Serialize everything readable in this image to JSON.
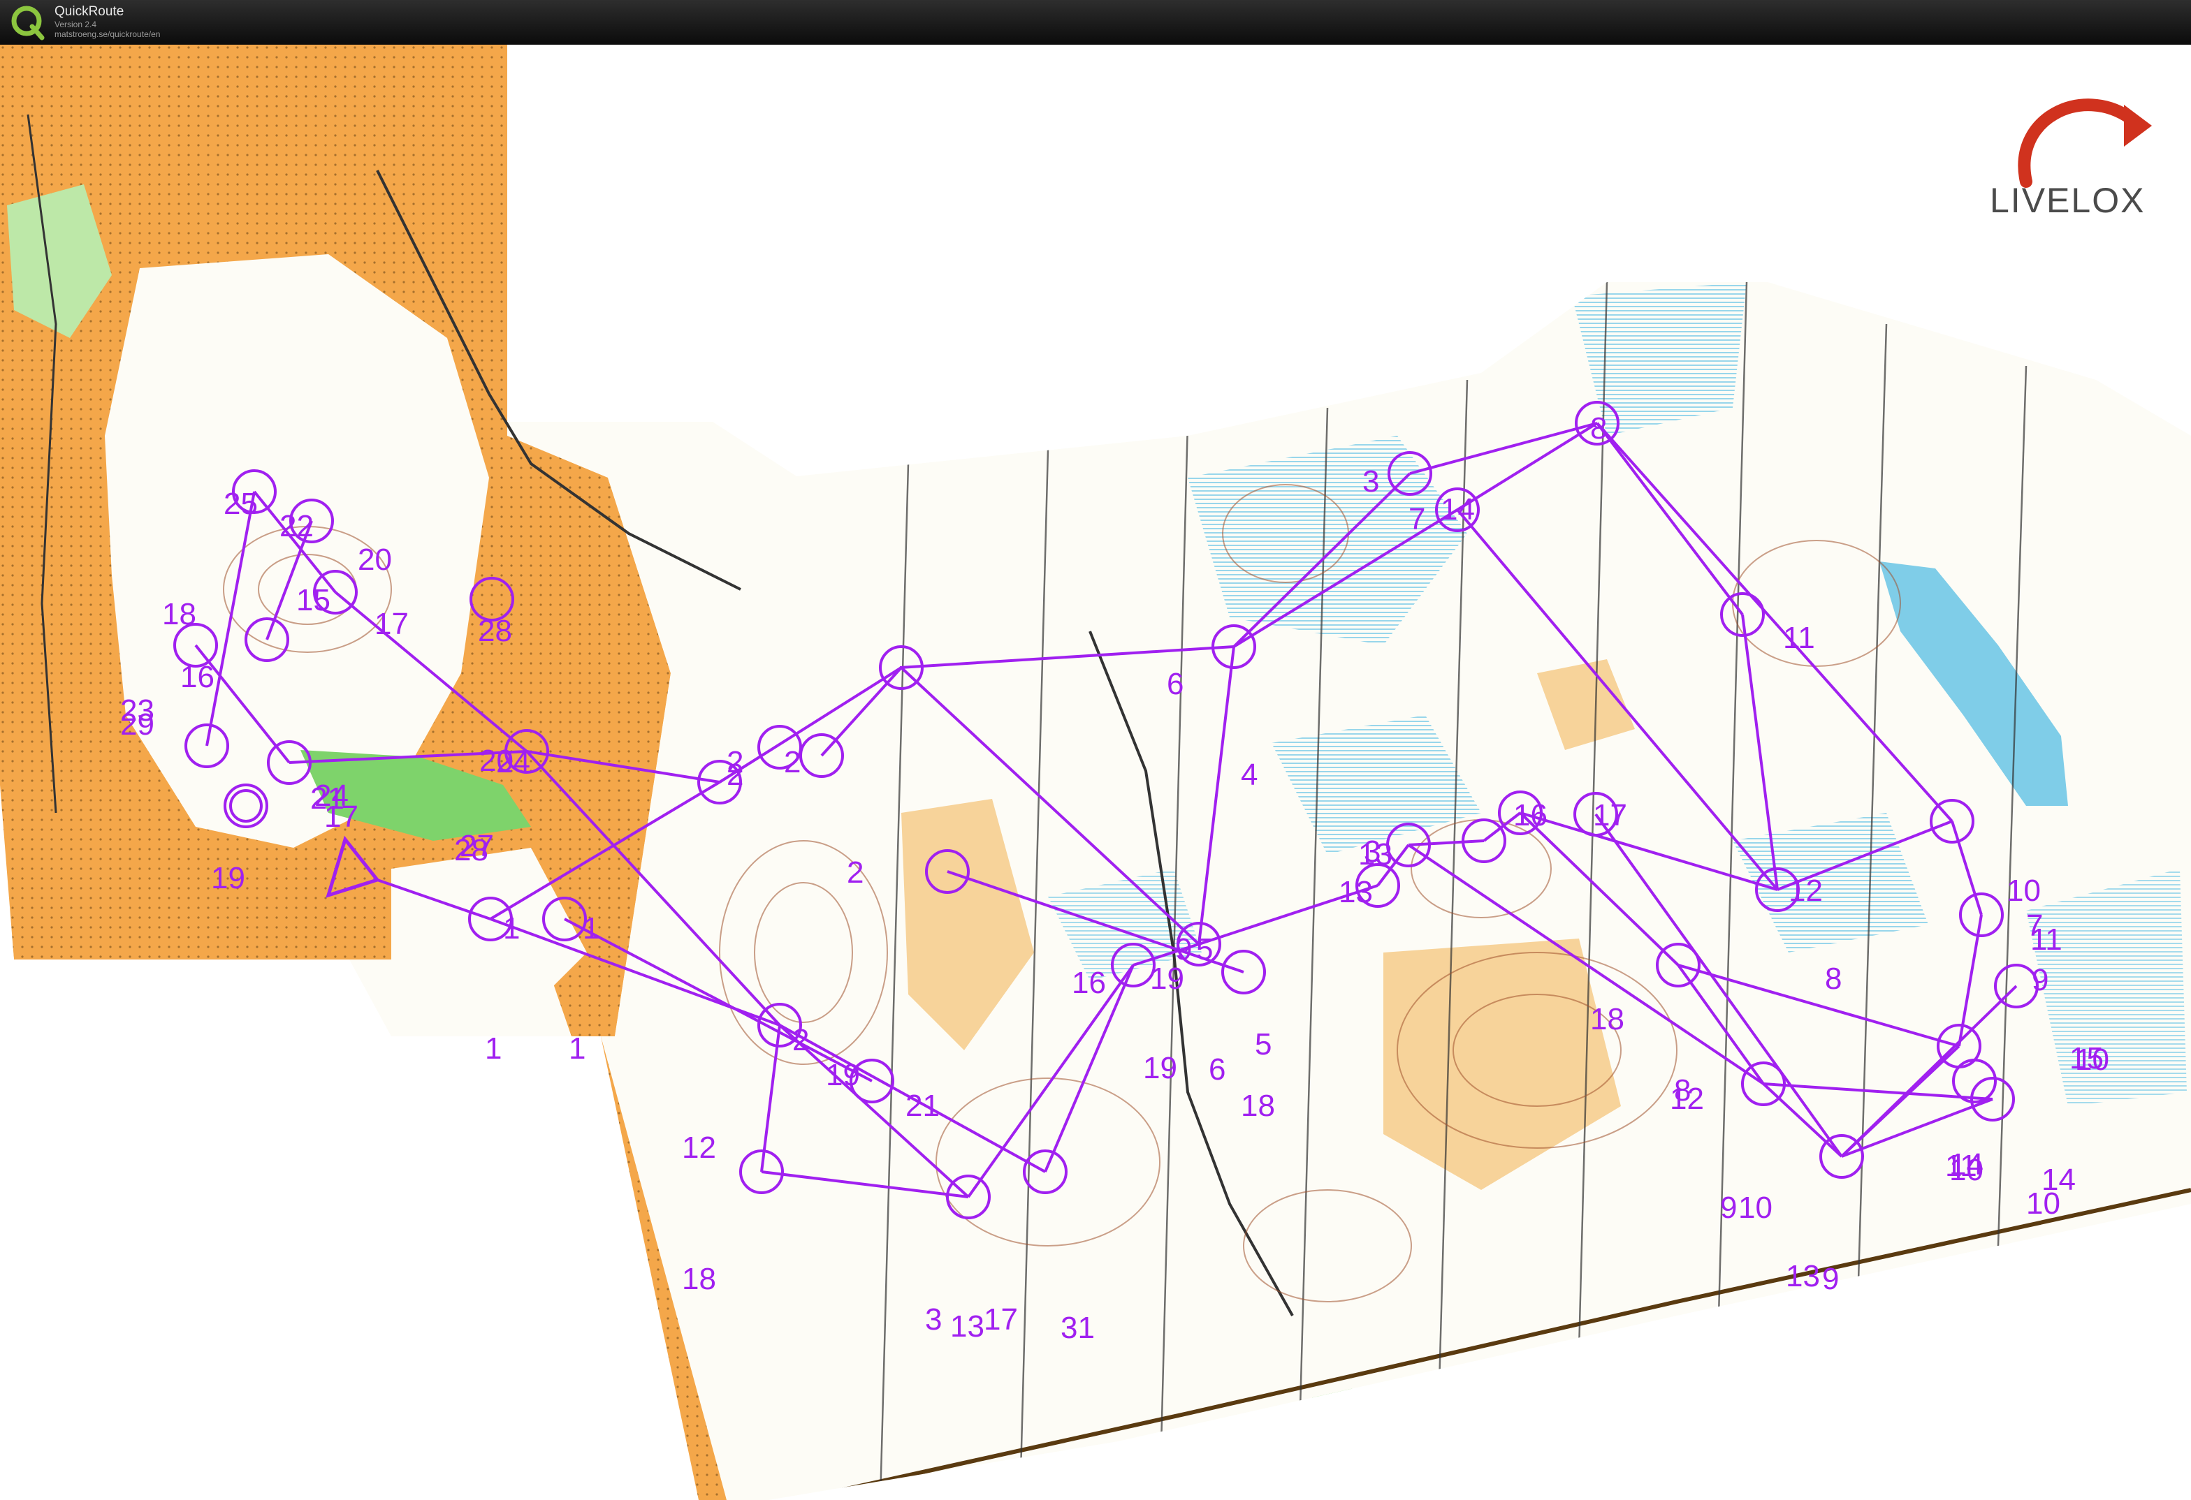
{
  "app": {
    "title": "QuickRoute",
    "version": "Version 2.4",
    "url": "matstroeng.se/quickroute/en"
  },
  "brand": {
    "name": "LIVELOX"
  },
  "colors": {
    "course": "#a020f0",
    "open_land": "#f4a74a",
    "forest_green": "#7ed36b",
    "marsh": "#8fd3ea",
    "water": "#7fcde8",
    "contour": "#a0522d",
    "brand_red": "#d0321e"
  },
  "map": {
    "start_triangle": "start",
    "labels": [
      "25",
      "22",
      "20",
      "18",
      "15",
      "17",
      "16",
      "23",
      "29",
      "24",
      "21",
      "28",
      "20",
      "28",
      "27",
      "19",
      "17",
      "1",
      "1",
      "1",
      "1",
      "2",
      "2",
      "2",
      "2",
      "2",
      "12",
      "19",
      "21",
      "18",
      "3",
      "13",
      "17",
      "31",
      "16",
      "19",
      "9",
      "5",
      "6",
      "18",
      "4",
      "6",
      "13",
      "3",
      "7",
      "14",
      "8",
      "11",
      "16",
      "17",
      "13",
      "12",
      "18",
      "12",
      "8",
      "10",
      "7",
      "11",
      "9",
      "15",
      "10",
      "14",
      "10",
      "9",
      "10",
      "13",
      "9",
      "14",
      "10",
      "11",
      "3",
      "24",
      "19",
      "5",
      "8"
    ]
  }
}
